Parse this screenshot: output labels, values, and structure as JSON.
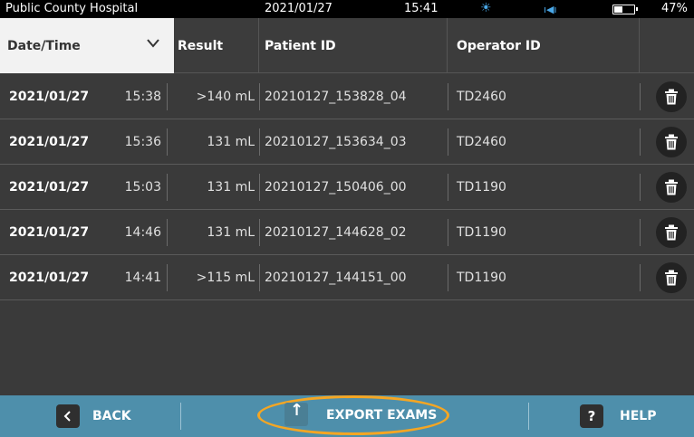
{
  "status_bar": {
    "hospital": "Public County Hospital",
    "date": "2021/01/27",
    "time": "15:41",
    "sun_icon": "sun-icon",
    "volume_icon": "volume-icon",
    "battery_percent": "47%",
    "battery_level": 0.47
  },
  "header": {
    "date_time": "Date/Time",
    "result": "Result",
    "patient_id": "Patient ID",
    "operator_id": "Operator ID"
  },
  "rows": [
    {
      "date": "2021/01/27",
      "time": "15:38",
      "result": ">140 mL",
      "patient_id": "20210127_153828_04",
      "operator_id": "TD2460"
    },
    {
      "date": "2021/01/27",
      "time": "15:36",
      "result": "131 mL",
      "patient_id": "20210127_153634_03",
      "operator_id": "TD2460"
    },
    {
      "date": "2021/01/27",
      "time": "15:03",
      "result": "131 mL",
      "patient_id": "20210127_150406_00",
      "operator_id": "TD1190"
    },
    {
      "date": "2021/01/27",
      "time": "14:46",
      "result": "131 mL",
      "patient_id": "20210127_144628_02",
      "operator_id": "TD1190"
    },
    {
      "date": "2021/01/27",
      "time": "14:41",
      "result": ">115 mL",
      "patient_id": "20210127_144151_00",
      "operator_id": "TD1190"
    }
  ],
  "bottom_bar": {
    "back_label": "BACK",
    "export_label": "EXPORT EXAMS",
    "help_label": "HELP",
    "help_icon_glyph": "?"
  },
  "colors": {
    "accent_blue": "#4e8fab",
    "highlight_ring": "#f5a623"
  }
}
